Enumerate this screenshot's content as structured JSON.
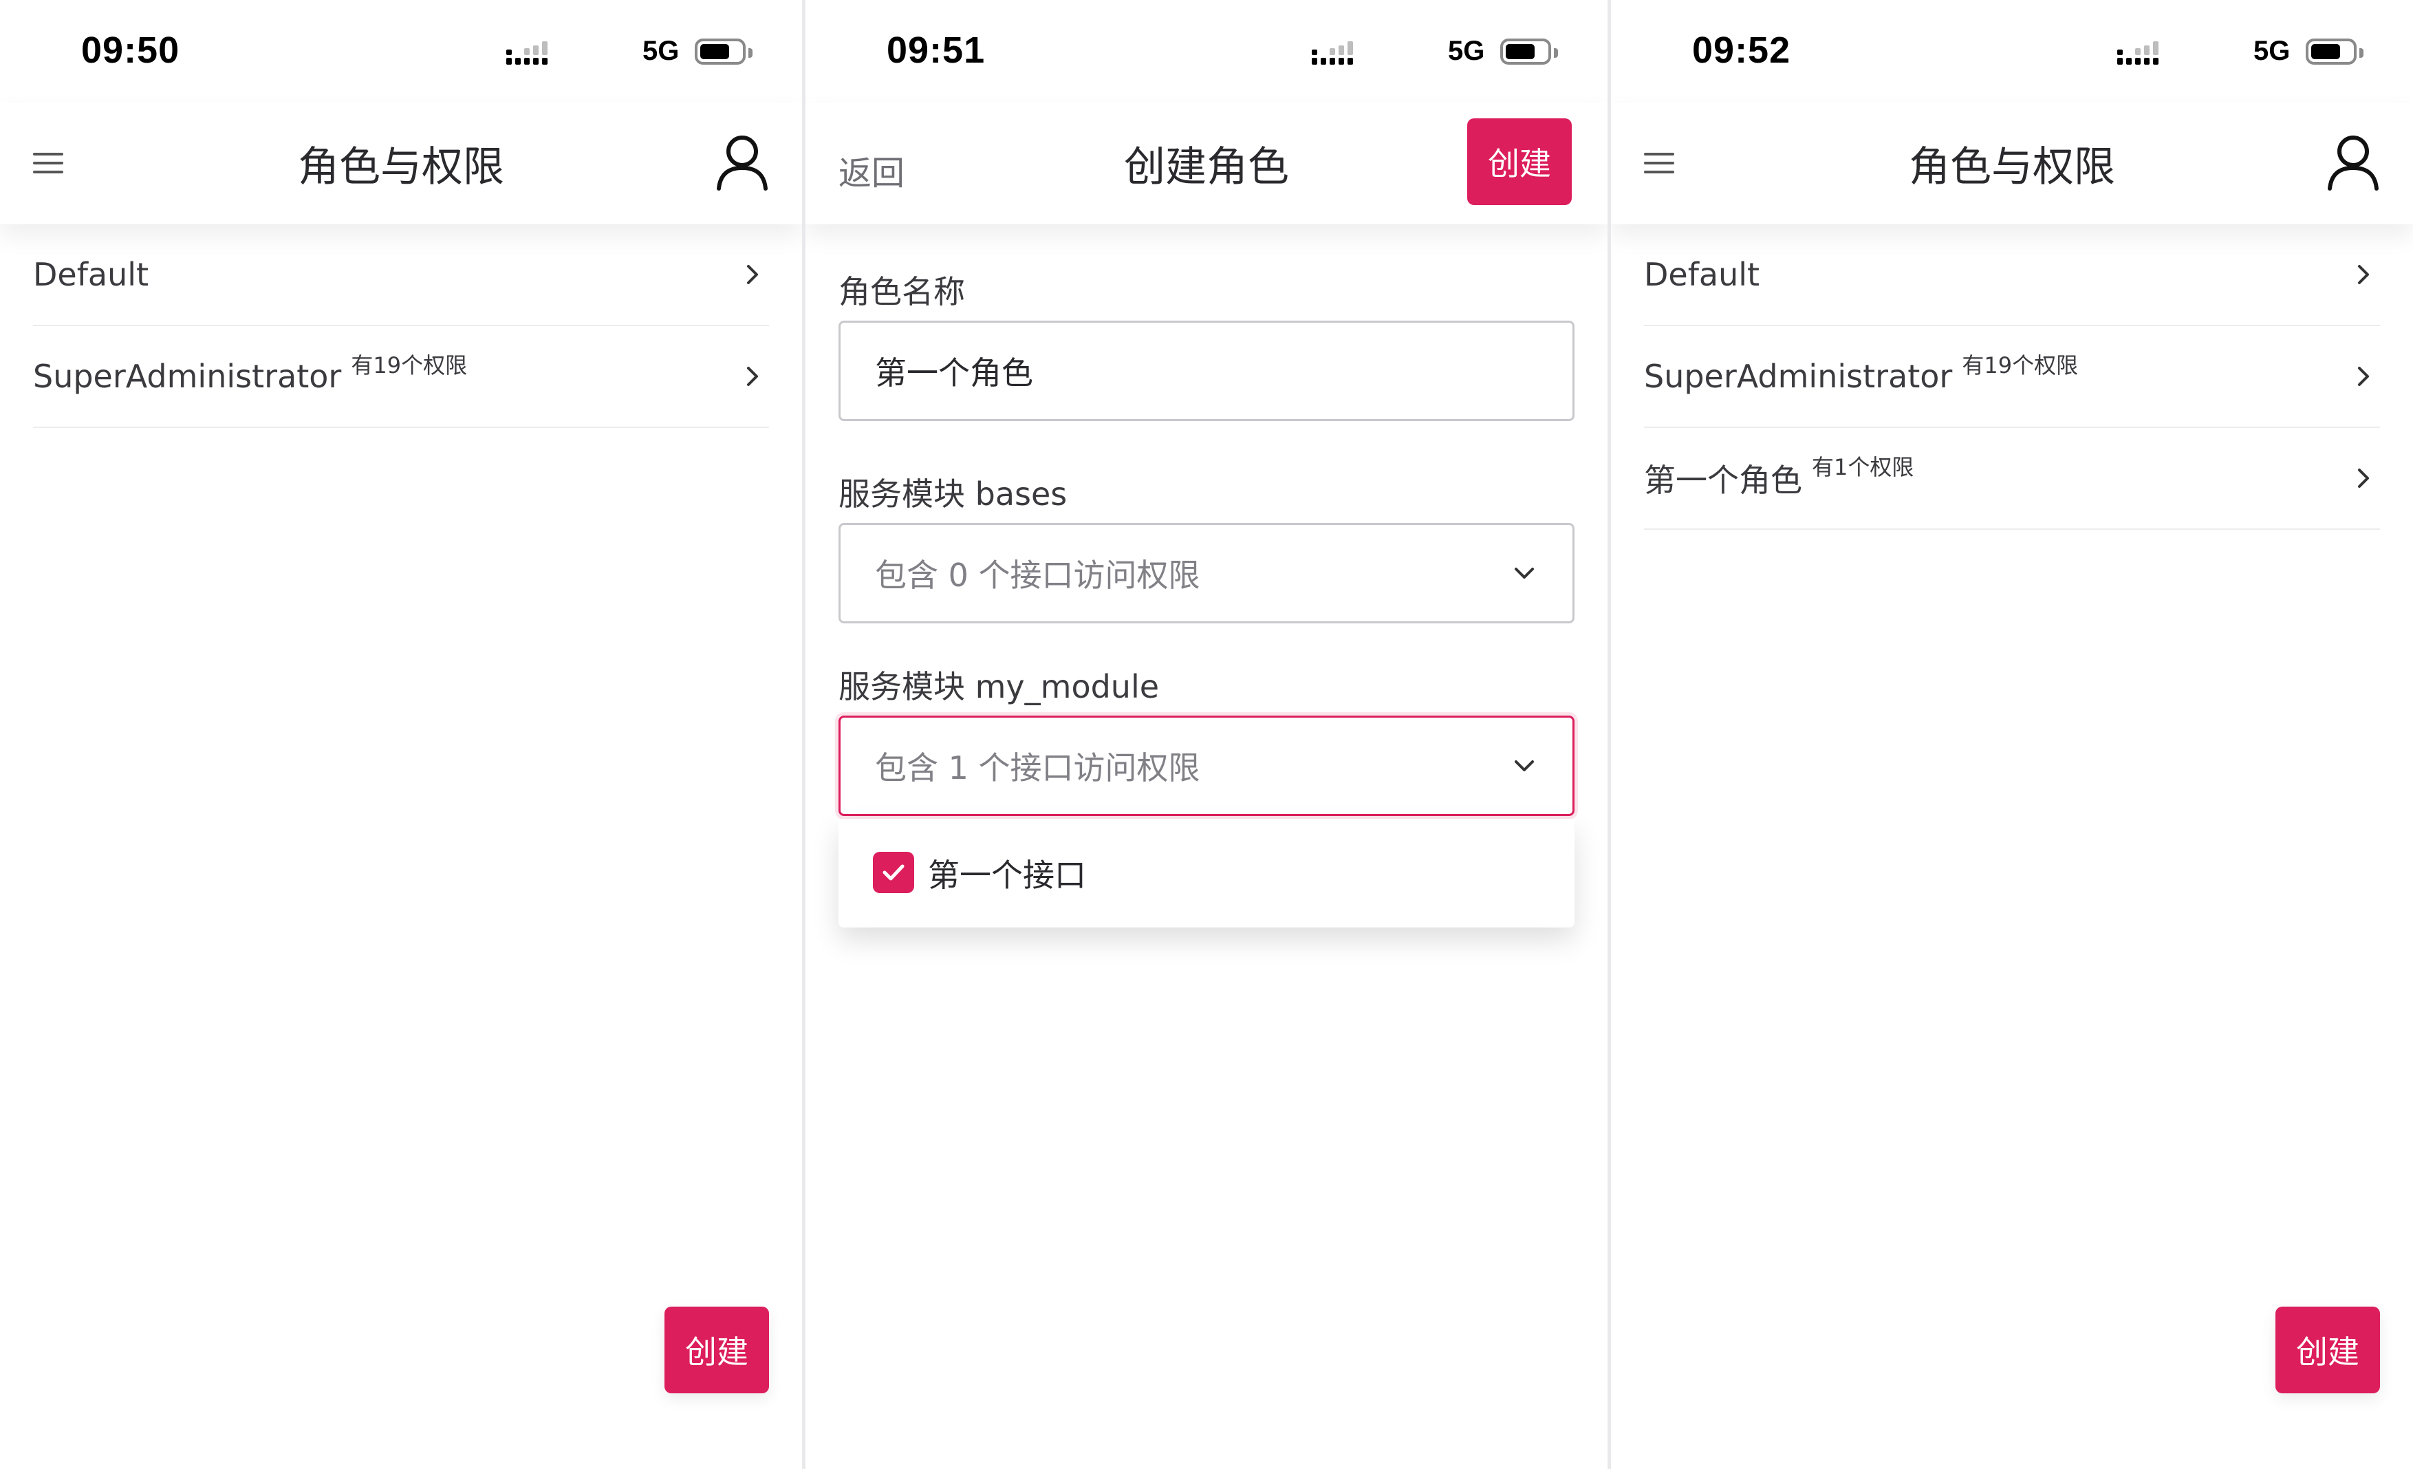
{
  "colors": {
    "accent": "#dc1e5d",
    "background": "#ffffff",
    "text": "#3a3a3f"
  },
  "screens": [
    {
      "status": {
        "time": "09:50",
        "network": "5G"
      },
      "header": {
        "title": "角色与权限"
      },
      "roles": [
        {
          "name": "Default",
          "permissions": ""
        },
        {
          "name": "SuperAdministrator",
          "permissions": "有19个权限"
        }
      ],
      "fab_label": "创建"
    },
    {
      "status": {
        "time": "09:51",
        "network": "5G"
      },
      "header": {
        "back": "返回",
        "title": "创建角色",
        "create": "创建"
      },
      "form": {
        "name_label": "角色名称",
        "name_value": "第一个角色",
        "modules": [
          {
            "label": "服务模块 bases",
            "summary": "包含 0 个接口访问权限"
          },
          {
            "label": "服务模块 my_module",
            "summary": "包含 1 个接口访问权限"
          }
        ],
        "dropdown_option": {
          "label": "第一个接口",
          "checked": true
        }
      }
    },
    {
      "status": {
        "time": "09:52",
        "network": "5G"
      },
      "header": {
        "title": "角色与权限"
      },
      "roles": [
        {
          "name": "Default",
          "permissions": ""
        },
        {
          "name": "SuperAdministrator",
          "permissions": "有19个权限"
        },
        {
          "name": "第一个角色",
          "permissions": "有1个权限"
        }
      ],
      "fab_label": "创建"
    }
  ]
}
